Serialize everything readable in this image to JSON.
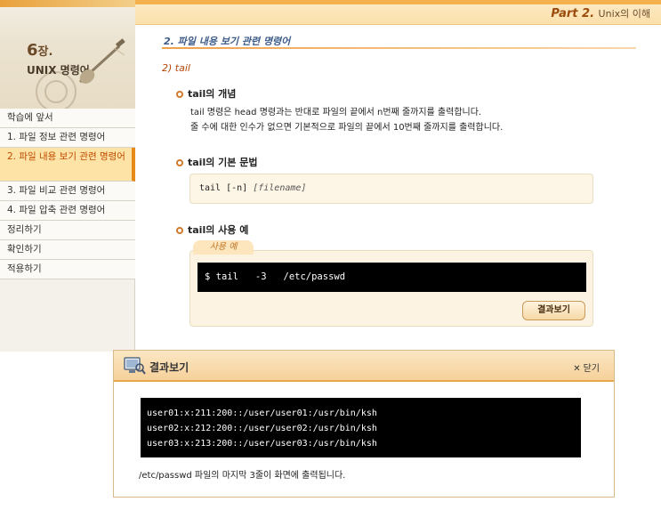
{
  "sidebar": {
    "chapter_number": "6",
    "chapter_suffix": "장.",
    "chapter_title": "UNIX 명령어",
    "menu": [
      {
        "label": "학습에 앞서"
      },
      {
        "label": "1. 파일 정보 관련 명령어"
      },
      {
        "label": "2. 파일 내용 보기 관련 명령어",
        "active": true
      },
      {
        "label": "3. 파일 비교 관련 명령어"
      },
      {
        "label": "4. 파일 압축 관련 명령어"
      },
      {
        "label": "정리하기"
      },
      {
        "label": "확인하기"
      },
      {
        "label": "적용하기"
      }
    ]
  },
  "header": {
    "part": "Part 2.",
    "part_title": "Unix의 이해"
  },
  "main": {
    "section_title": "2. 파일 내용 보기 관련 명령어",
    "subsection": "2) tail",
    "concept": {
      "heading": "tail의 개념",
      "line1": "tail 명령은 head 명령과는 반대로 파일의 끝에서 n번째 줄까지를 출력합니다.",
      "line2": "줄 수에 대한 인수가 없으면 기본적으로 파일의 끝에서 10번째 줄까지를 출력합니다."
    },
    "syntax": {
      "heading": "tail의 기본 문법",
      "command": "tail [-n]",
      "arg": "[filename]"
    },
    "example": {
      "heading": "tail의 사용 예",
      "tab_label": "사용 예",
      "command": "$ tail   -3   /etc/passwd",
      "button": "결과보기"
    }
  },
  "popup": {
    "title": "결과보기",
    "close_label": "닫기",
    "output": [
      "user01:x:211:200::/user/user01:/usr/bin/ksh",
      "user02:x:212:200::/user/user02:/usr/bin/ksh",
      "user03:x:213:200::/user/user03:/usr/bin/ksh"
    ],
    "note": "/etc/passwd 파일의 마지막 3줄이 화면에 출력됩니다."
  },
  "colors": {
    "accent": "#e88a1a",
    "active_menu_bg": "#fde3a6",
    "terminal_bg": "#000000"
  },
  "icons": [
    "guitar-illustration",
    "monitor-magnifier-icon",
    "close-x-icon",
    "bullet-circle-icon"
  ]
}
